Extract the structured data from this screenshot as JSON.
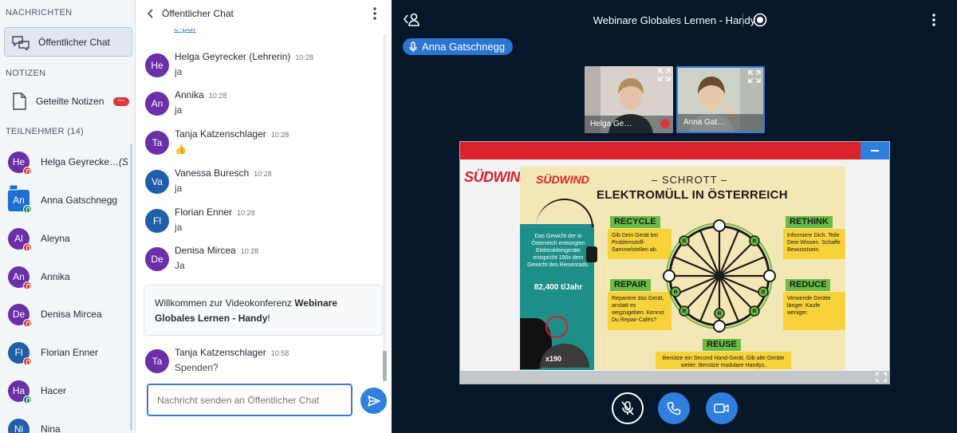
{
  "sidebar": {
    "messages_title": "NACHRICHTEN",
    "public_chat_label": "Öffentlicher Chat",
    "notes_title": "NOTIZEN",
    "shared_notes_label": "Geteilte Notizen",
    "notes_badge": "···",
    "participants_title": "TEILNEHMER (14)",
    "participants": [
      {
        "initials": "He",
        "name": "Helga Geyrecke…",
        "suffix": "(Sie)",
        "color": "#6b2fa8"
      },
      {
        "initials": "An",
        "name": "Anna Gatschnegg",
        "color": "#1f6fd2"
      },
      {
        "initials": "Al",
        "name": "Aleyna",
        "color": "#6b2fa8"
      },
      {
        "initials": "An",
        "name": "Annika",
        "color": "#6b2fa8"
      },
      {
        "initials": "De",
        "name": "Denisa Mircea",
        "color": "#6b2fa8"
      },
      {
        "initials": "Fl",
        "name": "Florian Enner",
        "color": "#1f5fa8"
      },
      {
        "initials": "Ha",
        "name": "Hacer",
        "color": "#6b2fa8"
      },
      {
        "initials": "Ni",
        "name": "Nina",
        "color": "#1f5fa8"
      }
    ]
  },
  "chat": {
    "header_title": "Öffentlicher Chat",
    "link_fragment": "e-pdf",
    "messages": [
      {
        "initials": "He",
        "name": "Helga Geyrecker (Lehrerin)",
        "time": "10:28",
        "text": "ja",
        "color": "#6b2fa8"
      },
      {
        "initials": "An",
        "name": "Annika",
        "time": "10:28",
        "text": "ja",
        "color": "#6b2fa8"
      },
      {
        "initials": "Ta",
        "name": "Tanja Katzenschlager",
        "time": "10:28",
        "text": "👍",
        "color": "#6b2fa8"
      },
      {
        "initials": "Va",
        "name": "Vanessa Buresch",
        "time": "10:28",
        "text": "ja",
        "color": "#1f5fa8"
      },
      {
        "initials": "Fl",
        "name": "Florian Enner",
        "time": "10:28",
        "text": "ja",
        "color": "#1f5fa8"
      },
      {
        "initials": "De",
        "name": "Denisa Mircea",
        "time": "10:28",
        "text": "Ja",
        "color": "#6b2fa8"
      },
      {
        "initials": "Ta",
        "name": "Tanja Katzenschlager",
        "time": "10:58",
        "text": "Spenden?",
        "color": "#6b2fa8"
      }
    ],
    "welcome_prefix": "Willkommen zur Videokonferenz ",
    "welcome_bold": "Webinare Globales Lernen - Handy",
    "welcome_suffix": "!",
    "input_placeholder": "Nachricht senden an Öffentlicher Chat"
  },
  "main": {
    "meeting_title": "Webinare Globales Lernen - Handy",
    "talking_user": "Anna Gatschnegg",
    "videos": [
      {
        "name": "Helga Ge…",
        "muted": true
      },
      {
        "name": "Anna Gat…",
        "muted": false
      }
    ],
    "slide": {
      "outer_logo": "SÜDWIND",
      "poster_logo": "SÜDWIND",
      "subtitle": "– SCHROTT –",
      "title": "ELEKTROMÜLL IN ÖSTERREICH",
      "teal_text": "Das Gewicht der in Österreich entsorgten Elektrokleingeräte entspricht 190x dem Gewicht des Riesenrads.",
      "teal_number": "82,400 t/Jahr",
      "mound_label": "x190",
      "wheel_letter": "R",
      "labels": {
        "recycle": "RECYCLE",
        "rethink": "RETHINK",
        "repair": "REPAIR",
        "reduce": "REDUCE",
        "reuse": "REUSE"
      },
      "texts": {
        "recycle": "Gib Dein Gerät bei Problemstoff-Sammelstellen ab.",
        "rethink": "Informiere Dich. Teile Dein Wissen. Schaffe Bewusstsein.",
        "repair": "Repariere das Gerät, anstatt es wegzugeben. Kennst Du Repair-Cafés?",
        "reduce": "Verwende Geräte länger. Kaufe weniger.",
        "reuse": "Benütze ein Second Hand-Gerät. Gib alte Geräte weiter. Benütze modulare Handys."
      }
    }
  },
  "colors": {
    "accent": "#2f7fde",
    "danger": "#d9383a",
    "background_dark": "#06172a"
  }
}
